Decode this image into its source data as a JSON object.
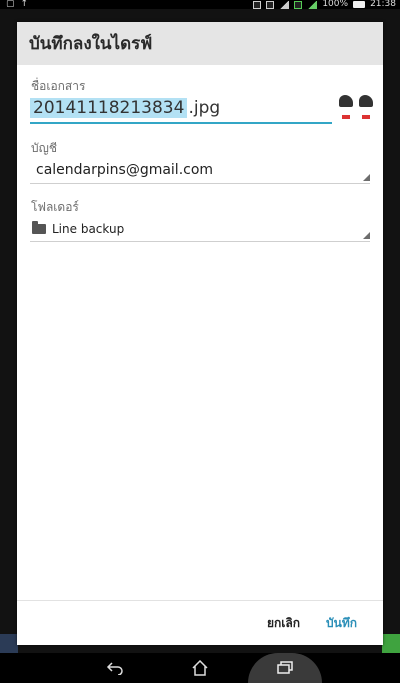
{
  "status_bar": {
    "left_icons": [
      "sync-icon",
      "upload-icon"
    ],
    "battery": "100%",
    "time": "21:38"
  },
  "dialog": {
    "title": "บันทึกลงในไดรฟ์",
    "document_name": {
      "label": "ชื่อเอกสาร",
      "selected_text": "20141118213834",
      "extension": ".jpg"
    },
    "account": {
      "label": "บัญชี",
      "value": "calendarpins@gmail.com"
    },
    "folder": {
      "label": "โฟลเดอร์",
      "value": "Line backup",
      "icon": "folder-icon"
    },
    "buttons": {
      "cancel": "ยกเลิก",
      "save": "บันทึก"
    }
  },
  "colors": {
    "accent": "#33a6c6",
    "selection": "#b3e1f4",
    "save_button": "#2b8fb8",
    "header_bg": "#e5e5e5"
  },
  "nav_bar": {
    "icons": [
      "back-icon",
      "home-icon",
      "recent-apps-icon"
    ]
  }
}
